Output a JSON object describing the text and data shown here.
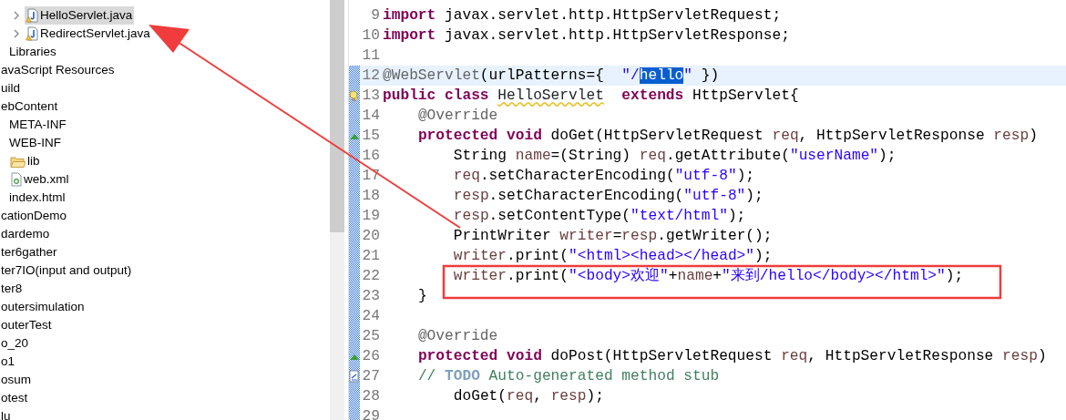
{
  "tree": [
    {
      "children": [
        {
          "children": [
            {
              "children": [
                {
                  "label": "HelloServlet.java",
                  "kind": "java",
                  "selected": true,
                  "expanded": false
                },
                {
                  "label": "RedirectServlet.java",
                  "kind": "java",
                  "selected": false,
                  "expanded": false
                }
              ]
            }
          ]
        },
        {
          "label": "Libraries",
          "selected": false
        }
      ]
    },
    {
      "label": "avaScript Resources",
      "selected": false
    },
    {
      "label": "uild",
      "selected": false
    },
    {
      "label": "ebContent",
      "selected": false,
      "children": [
        {
          "label": "META-INF",
          "selected": false
        },
        {
          "label": "WEB-INF",
          "selected": false,
          "children": [
            {
              "label": "lib",
              "kind": "folder",
              "selected": false
            },
            {
              "label": "web.xml",
              "kind": "xml",
              "selected": false
            }
          ]
        },
        {
          "label": "index.html",
          "selected": false
        }
      ]
    },
    {
      "label": "cationDemo",
      "selected": false
    },
    {
      "label": "dardemo",
      "selected": false
    },
    {
      "label": "ter6gather",
      "selected": false
    },
    {
      "label": "ter7IO(input and output)",
      "selected": false
    },
    {
      "label": "ter8",
      "selected": false
    },
    {
      "label": "outersimulation",
      "selected": false
    },
    {
      "label": "outerTest",
      "selected": false
    },
    {
      "label": "o_20",
      "selected": false
    },
    {
      "label": "o1",
      "selected": false
    },
    {
      "label": "osum",
      "selected": false
    },
    {
      "label": "otest",
      "selected": false
    },
    {
      "label": "lu",
      "selected": false
    }
  ],
  "editor": {
    "lines": [
      {
        "number": "9",
        "in_range": false,
        "segments": [
          {
            "kind": "keyword",
            "text": "import"
          },
          {
            "kind": "plain",
            "text": " javax.servlet.http.HttpServletRequest;"
          }
        ]
      },
      {
        "number": "10",
        "in_range": false,
        "segments": [
          {
            "kind": "keyword",
            "text": "import"
          },
          {
            "kind": "plain",
            "text": " javax.servlet.http.HttpServletResponse;"
          }
        ]
      },
      {
        "number": "11",
        "in_range": false
      },
      {
        "number": "12",
        "in_range": true,
        "current": true,
        "segments": [
          {
            "kind": "annotation",
            "text": "@WebServlet"
          },
          {
            "kind": "plain",
            "text": "(urlPatterns={  "
          },
          {
            "kind": "string",
            "text": "\"/"
          },
          {
            "kind": "selection",
            "text": "hello"
          },
          {
            "kind": "string",
            "text": "\""
          },
          {
            "kind": "plain",
            "text": " })"
          }
        ]
      },
      {
        "number": "13",
        "in_range": true,
        "kind": "warning",
        "segments": [
          {
            "kind": "keyword",
            "text": "public class "
          },
          {
            "kind": "warning",
            "text": "HelloServlet"
          },
          {
            "kind": "keyword",
            "text": "  extends"
          },
          {
            "kind": "plain",
            "text": " HttpServlet{"
          }
        ]
      },
      {
        "number": "14",
        "in_range": true,
        "segments": [
          {
            "kind": "annotation",
            "text": "    @Override"
          }
        ]
      },
      {
        "number": "15",
        "in_range": true,
        "kind": "override",
        "segments": [
          {
            "kind": "keyword",
            "text": "    protected void"
          },
          {
            "kind": "plain",
            "text": " doGet(HttpServletRequest "
          },
          {
            "kind": "variable",
            "text": "req"
          },
          {
            "kind": "plain",
            "text": ", HttpServletResponse "
          },
          {
            "kind": "variable",
            "text": "resp"
          },
          {
            "kind": "plain",
            "text": ")"
          }
        ]
      },
      {
        "number": "16",
        "in_range": true,
        "segments": [
          {
            "kind": "plain",
            "text": "        String "
          },
          {
            "kind": "variable",
            "text": "name"
          },
          {
            "kind": "plain",
            "text": "=(String) "
          },
          {
            "kind": "variable",
            "text": "req"
          },
          {
            "kind": "plain",
            "text": ".getAttribute("
          },
          {
            "kind": "string",
            "text": "\"userName\""
          },
          {
            "kind": "plain",
            "text": ");"
          }
        ]
      },
      {
        "number": "17",
        "in_range": true,
        "segments": [
          {
            "kind": "variable",
            "text": "        req"
          },
          {
            "kind": "plain",
            "text": ".setCharacterEncoding("
          },
          {
            "kind": "string",
            "text": "\"utf-8\""
          },
          {
            "kind": "plain",
            "text": ");"
          }
        ]
      },
      {
        "number": "18",
        "in_range": true,
        "segments": [
          {
            "kind": "variable",
            "text": "        resp"
          },
          {
            "kind": "plain",
            "text": ".setCharacterEncoding("
          },
          {
            "kind": "string",
            "text": "\"utf-8\""
          },
          {
            "kind": "plain",
            "text": ");"
          }
        ]
      },
      {
        "number": "19",
        "in_range": true,
        "segments": [
          {
            "kind": "variable",
            "text": "        resp"
          },
          {
            "kind": "plain",
            "text": ".setContentType("
          },
          {
            "kind": "string",
            "text": "\"text/html\""
          },
          {
            "kind": "plain",
            "text": ");"
          }
        ]
      },
      {
        "number": "20",
        "in_range": true,
        "segments": [
          {
            "kind": "plain",
            "text": "        PrintWriter "
          },
          {
            "kind": "variable",
            "text": "writer"
          },
          {
            "kind": "plain",
            "text": "="
          },
          {
            "kind": "variable",
            "text": "resp"
          },
          {
            "kind": "plain",
            "text": ".getWriter();"
          }
        ]
      },
      {
        "number": "21",
        "in_range": true,
        "segments": [
          {
            "kind": "variable",
            "text": "        writer"
          },
          {
            "kind": "plain",
            "text": ".print("
          },
          {
            "kind": "string",
            "text": "\"<html><head></head>\""
          },
          {
            "kind": "plain",
            "text": ");"
          }
        ]
      },
      {
        "number": "22",
        "in_range": true,
        "segments": [
          {
            "kind": "variable",
            "text": "        writer"
          },
          {
            "kind": "plain",
            "text": ".print("
          },
          {
            "kind": "string",
            "text": "\"<body>欢迎\""
          },
          {
            "kind": "plain",
            "text": "+"
          },
          {
            "kind": "variable",
            "text": "name"
          },
          {
            "kind": "plain",
            "text": "+"
          },
          {
            "kind": "string",
            "text": "\"来到/hello</body></html>\""
          },
          {
            "kind": "plain",
            "text": ");"
          }
        ]
      },
      {
        "number": "23",
        "in_range": true,
        "segments": [
          {
            "kind": "plain",
            "text": "    }"
          }
        ]
      },
      {
        "number": "24",
        "in_range": true
      },
      {
        "number": "25",
        "in_range": true,
        "segments": [
          {
            "kind": "annotation",
            "text": "    @Override"
          }
        ]
      },
      {
        "number": "26",
        "in_range": true,
        "kind": "override",
        "segments": [
          {
            "kind": "keyword",
            "text": "    protected void"
          },
          {
            "kind": "plain",
            "text": " doPost(HttpServletRequest "
          },
          {
            "kind": "variable",
            "text": "req"
          },
          {
            "kind": "plain",
            "text": ", HttpServletResponse "
          },
          {
            "kind": "variable",
            "text": "resp"
          },
          {
            "kind": "plain",
            "text": ")"
          }
        ]
      },
      {
        "number": "27",
        "in_range": true,
        "kind": "task",
        "segments": [
          {
            "kind": "comment",
            "text": "    // "
          },
          {
            "kind": "todo",
            "text": "TODO"
          },
          {
            "kind": "comment",
            "text": " Auto-generated method stub"
          }
        ]
      },
      {
        "number": "28",
        "in_range": true,
        "segments": [
          {
            "kind": "plain",
            "text": "        doGet("
          },
          {
            "kind": "variable",
            "text": "req"
          },
          {
            "kind": "plain",
            "text": ", "
          },
          {
            "kind": "variable",
            "text": "resp"
          },
          {
            "kind": "plain",
            "text": ");"
          }
        ]
      },
      {
        "number": "29",
        "in_range": true
      }
    ]
  }
}
